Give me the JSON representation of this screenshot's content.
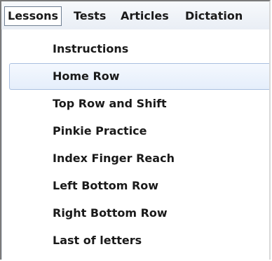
{
  "menubar": {
    "items": [
      {
        "label": "Lessons",
        "active": true
      },
      {
        "label": "Tests",
        "active": false
      },
      {
        "label": "Articles",
        "active": false
      },
      {
        "label": "Dictation",
        "active": false
      }
    ]
  },
  "dropdown": {
    "items": [
      {
        "label": "Instructions"
      },
      {
        "label": "Home Row",
        "highlighted": true
      },
      {
        "label": "Top Row and Shift"
      },
      {
        "label": "Pinkie Practice"
      },
      {
        "label": "Index Finger Reach"
      },
      {
        "label": "Left Bottom Row"
      },
      {
        "label": "Right Bottom Row"
      },
      {
        "label": "Last of letters"
      }
    ]
  },
  "colors": {
    "highlight_border": "#a9bfe0",
    "highlight_fill": "#e5eefb",
    "active_menu_border": "#6f7f92"
  }
}
